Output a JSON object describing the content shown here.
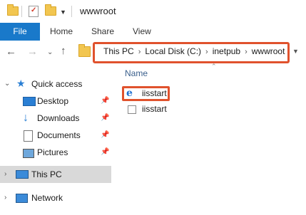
{
  "window": {
    "title": "wwwroot"
  },
  "ribbon": {
    "tabs": [
      {
        "label": "File"
      },
      {
        "label": "Home"
      },
      {
        "label": "Share"
      },
      {
        "label": "View"
      }
    ]
  },
  "address": {
    "crumbs": [
      "This PC",
      "Local Disk (C:)",
      "inetpub",
      "wwwroot"
    ]
  },
  "nav": {
    "quick_access": "Quick access",
    "desktop": "Desktop",
    "downloads": "Downloads",
    "documents": "Documents",
    "pictures": "Pictures",
    "this_pc": "This PC",
    "network": "Network"
  },
  "content": {
    "column_name": "Name",
    "files": [
      {
        "name": "iisstart",
        "icon": "ie-html-icon"
      },
      {
        "name": "iisstart",
        "icon": "image-file-icon"
      }
    ]
  },
  "colors": {
    "file_tab": "#1979ca",
    "highlight": "#e0522d",
    "selected_nav": "#d9d9d9",
    "folder": "#f2c650"
  }
}
